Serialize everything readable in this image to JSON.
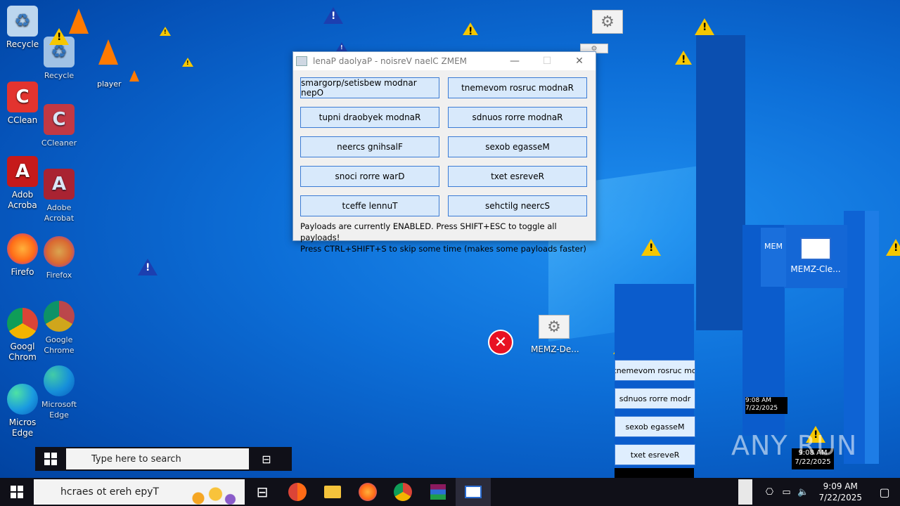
{
  "desktop": {
    "icons_left": [
      {
        "id": "recycle",
        "label": "Recycle",
        "glyph": "♻",
        "class": "g-bin"
      },
      {
        "id": "ccleaner",
        "label": "CClean",
        "glyph": "C",
        "class": "g-cc"
      },
      {
        "id": "acrobat",
        "label": "Adob\nAcroba",
        "glyph": "A",
        "class": "g-pdf"
      },
      {
        "id": "firefox",
        "label": "Firefo",
        "glyph": "",
        "class": "g-ff"
      },
      {
        "id": "chrome",
        "label": "Googl\nChrom",
        "glyph": "",
        "class": "g-chrome"
      },
      {
        "id": "edge",
        "label": "Micros\nEdge",
        "glyph": "",
        "class": "g-edge"
      }
    ],
    "icons_ghost": [
      {
        "id": "recycle2",
        "label": "Recycle",
        "glyph": "♻",
        "class": "g-bin"
      },
      {
        "id": "ccleaner2",
        "label": "CCleaner",
        "glyph": "C",
        "class": "g-cc"
      },
      {
        "id": "acrobat2",
        "label": "Adobe\nAcrobat",
        "glyph": "A",
        "class": "g-pdf"
      },
      {
        "id": "firefox2",
        "label": "Firefox",
        "glyph": "",
        "class": "g-ff"
      },
      {
        "id": "chrome2",
        "label": "Google\nChrome",
        "glyph": "",
        "class": "g-chrome"
      },
      {
        "id": "edge2",
        "label": "Microsoft\nEdge",
        "glyph": "",
        "class": "g-edge"
      }
    ],
    "player_label": "player",
    "memz_destructive_label": "MEMZ-De...",
    "memz_clean_label": "MEMZ-Cle...",
    "memz_short_label": "MEM",
    "watermark": "ANY RUN"
  },
  "dialog": {
    "title": "lenaP daolyaP - noisreV naelC ZMEM",
    "buttons": [
      "smargorp/setisbew modnar nepO",
      "tnemevom rosruc modnaR",
      "tupni draobyek modnaR",
      "sdnuos rorre modnaR",
      "neercs gnihsalF",
      "sexob egasseM",
      "snoci rorre warD",
      "txet esreveR",
      "tceffe lennuT",
      "sehctilg neercS"
    ],
    "status_line1": "Payloads are currently ENABLED. Press SHIFT+ESC to toggle all payloads!",
    "status_line2": "Press CTRL+SHIFT+S to skip some time (makes some payloads faster)"
  },
  "fragments": [
    "tnemevom rosruc mo",
    "sdnuos rorre modr",
    "sexob egasseM",
    "txet esreveR"
  ],
  "taskbar": {
    "search_placeholder": "hcraes ot ereh epyT",
    "mini_search_placeholder": "Type here to search",
    "time": "9:09 AM",
    "date": "7/22/2025",
    "ghost_time": "9:08 AM",
    "ghost_date": "7/22/2025"
  }
}
